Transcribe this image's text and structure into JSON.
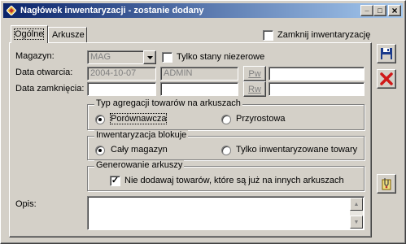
{
  "window": {
    "title": "Nagłówek inwentaryzacji - zostanie dodany",
    "buttons": {
      "minimize": "_",
      "maximize": "□",
      "close": "×"
    }
  },
  "tabs": [
    {
      "label": "Ogólne",
      "active": true
    },
    {
      "label": "Arkusze",
      "active": false
    }
  ],
  "close_inventory": {
    "label": "Zamknij inwentaryzację",
    "checked": false
  },
  "form": {
    "magazyn_label": "Magazyn:",
    "magazyn_value": "MAG",
    "only_nonzero": {
      "label": "Tylko stany niezerowe",
      "checked": false
    },
    "open_date_label": "Data otwarcia:",
    "open_date_value": "2004-10-07",
    "open_user_value": "ADMIN",
    "open_pw_button": "Pw",
    "open_extra_value": "",
    "close_date_label": "Data zamknięcia:",
    "close_date_value": "",
    "close_user_value": "",
    "close_rw_button": "Rw",
    "close_extra_value": ""
  },
  "aggregation": {
    "title": "Typ agregacji towarów na arkuszach",
    "options": [
      {
        "label": "Porównawcza",
        "selected": true
      },
      {
        "label": "Przyrostowa",
        "selected": false
      }
    ]
  },
  "blocking": {
    "title": "Inwentaryzacja blokuje",
    "options": [
      {
        "label": "Cały magazyn",
        "selected": true
      },
      {
        "label": "Tylko inwentaryzowane towary",
        "selected": false
      }
    ]
  },
  "generation": {
    "title": "Generowanie arkuszy",
    "no_duplicates": {
      "label": "Nie dodawaj towarów, które są już na innych arkuszach",
      "checked": true
    }
  },
  "description": {
    "label": "Opis:",
    "value": ""
  },
  "colors": {
    "titlebar_start": "#0a246a",
    "titlebar_end": "#a6caf0",
    "face": "#d4d0c8",
    "save_icon": "#1a3a8c",
    "delete_icon": "#d01818"
  },
  "icons": {
    "title": "diamond-app-icon",
    "save": "floppy-disk-icon",
    "delete": "red-x-icon",
    "attach": "document-clip-icon",
    "dropdown": "chevron-down-icon"
  }
}
